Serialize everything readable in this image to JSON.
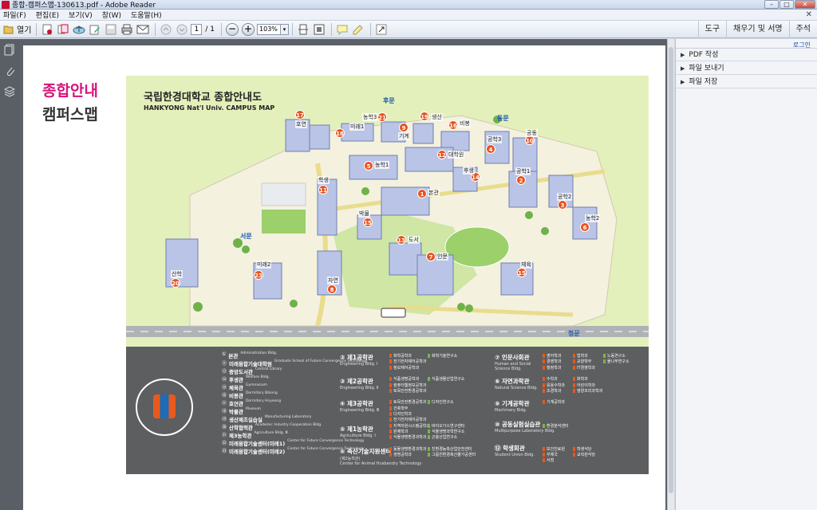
{
  "window": {
    "title": "종합-캠퍼스맵-130613.pdf - Adobe Reader",
    "min": "–",
    "max": "□",
    "close": "✕"
  },
  "menu": {
    "items": [
      "파일(F)",
      "편집(E)",
      "보기(V)",
      "창(W)",
      "도움말(H)"
    ],
    "close": "✕"
  },
  "toolbar": {
    "open_label": "열기",
    "page_current": "1",
    "page_total": "/ 1",
    "zoom": "103%",
    "zoom_out": "−",
    "zoom_in": "+",
    "right_tabs": [
      "도구",
      "채우기 및 서명",
      "주석"
    ]
  },
  "right_pane": {
    "login": "로그인",
    "items": [
      "PDF 작성",
      "파일 보내기",
      "파일 저장"
    ]
  },
  "document": {
    "heading_1": "종합안내",
    "heading_2": "캠퍼스맵",
    "map_title_ko": "국립한경대학교 종합안내도",
    "map_title_en": "HANKYONG Nat'l Univ.  CAMPUS MAP",
    "gates": {
      "back": "후문",
      "east": "동문",
      "west": "서문",
      "main": "정문"
    },
    "map_labels": [
      {
        "num": "17",
        "text": "호연"
      },
      {
        "num": "18",
        "text": "미래1"
      },
      {
        "num": "21",
        "text": "농학3"
      },
      {
        "num": "9",
        "text": "기계"
      },
      {
        "num": "19",
        "text": "생산"
      },
      {
        "num": "16",
        "text": "비봉"
      },
      {
        "num": "4",
        "text": "공학3"
      },
      {
        "num": "10",
        "text": "공동"
      },
      {
        "num": "5",
        "text": "농학1"
      },
      {
        "num": "12",
        "text": "대학원"
      },
      {
        "num": "14",
        "text": "후생"
      },
      {
        "num": "2",
        "text": "공학1"
      },
      {
        "num": "11",
        "text": "학생"
      },
      {
        "num": "1",
        "text": "본관"
      },
      {
        "num": "3",
        "text": "공학2"
      },
      {
        "num": "6",
        "text": "농학2"
      },
      {
        "num": "15",
        "text": "박물"
      },
      {
        "num": "13",
        "text": "도서"
      },
      {
        "num": "7",
        "text": "인문"
      },
      {
        "num": "15",
        "text": "체육"
      },
      {
        "num": "20",
        "text": "산학"
      },
      {
        "num": "23",
        "text": "미래2"
      },
      {
        "num": "8",
        "text": "자연"
      }
    ],
    "legend_left": [
      {
        "num": "①",
        "name": "본관",
        "en": "Administration Bldg."
      },
      {
        "num": "⑪",
        "name": "미래융합기술대학원",
        "en": "Graduate School of Future Convergence Technology"
      },
      {
        "num": "⑬",
        "name": "중앙도서관",
        "en": "Central Library"
      },
      {
        "num": "⑭",
        "name": "후생관",
        "en": "Welfare Bldg."
      },
      {
        "num": "⑮",
        "name": "체육관",
        "en": "Gymnasium"
      },
      {
        "num": "⑯",
        "name": "비봉관",
        "en": "Dormitory Bibong"
      },
      {
        "num": "⑰",
        "name": "호연관",
        "en": "Dormitory Hoyeong"
      },
      {
        "num": "⑱",
        "name": "박물관",
        "en": "Museum"
      },
      {
        "num": "⑲",
        "name": "생산제조실습실",
        "en": "Manufacturing Laboratory"
      },
      {
        "num": "⑳",
        "name": "산학협력관",
        "en": "Academic Industry Cooperation Bldg."
      },
      {
        "num": "㉑",
        "name": "제3농학관",
        "en": "Agriculture Bldg. Ⅲ"
      },
      {
        "num": "㉒",
        "name": "미래융합기술센터(미래1)",
        "en": "Center for Future Convergence Technology"
      },
      {
        "num": "㉓",
        "name": "미래융합기술센터(미래2)",
        "en": "Center for Future Convergence Technology"
      }
    ],
    "legend_mid": [
      {
        "num": "②",
        "name": "제1공학관",
        "en": "Engineering Bldg. Ⅰ"
      },
      {
        "num": "③",
        "name": "제2공학관",
        "en": "Engineering Bldg. Ⅱ"
      },
      {
        "num": "④",
        "name": "제3공학관",
        "en": "Engineering Bldg. Ⅲ"
      },
      {
        "num": "⑤",
        "name": "제1농학관",
        "en": "Agriculture Bldg. Ⅰ"
      },
      {
        "num": "⑥",
        "name": "축산기술지원센터",
        "en": "Center for Animal Husbandry Technology"
      }
    ],
    "legend_mid_sub": "(제2농학관)",
    "legend_right": [
      {
        "num": "⑦",
        "name": "인문사회관",
        "en": "Human and Social Science Bldg."
      },
      {
        "num": "⑧",
        "name": "자연과학관",
        "en": "Natural Science Bldg."
      },
      {
        "num": "⑨",
        "name": "기계공학관",
        "en": "Machinery Bldg."
      },
      {
        "num": "⑩",
        "name": "공동실험실습관",
        "en": "Multipurpose Laboratory Bldg."
      },
      {
        "num": "⑫",
        "name": "학생회관",
        "en": "Student Union Bldg."
      }
    ],
    "depts": [
      {
        "col": 0,
        "row": 0,
        "text": "화학공학과",
        "green": false
      },
      {
        "col": 1,
        "row": 0,
        "text": "화학기술연구소",
        "green": true
      },
      {
        "col": 0,
        "row": 1,
        "text": "전기전자제어공학과",
        "green": false
      },
      {
        "col": 0,
        "row": 2,
        "text": "정보제어공학과",
        "green": false
      },
      {
        "col": 0,
        "row": 4,
        "text": "식품생명공학과",
        "green": false
      },
      {
        "col": 1,
        "row": 4,
        "text": "식품생물산업연구소",
        "green": true
      },
      {
        "col": 0,
        "row": 5,
        "text": "컴퓨터웹정보공학과",
        "green": false
      },
      {
        "col": 0,
        "row": 6,
        "text": "토목안전환경공학과",
        "green": false
      },
      {
        "col": 0,
        "row": 8,
        "text": "토목안전환경공학과",
        "green": false
      },
      {
        "col": 1,
        "row": 8,
        "text": "디자인연구소",
        "green": true
      },
      {
        "col": 0,
        "row": 9,
        "text": "건축학부",
        "green": false
      },
      {
        "col": 0,
        "row": 10,
        "text": "디자인학과",
        "green": false
      },
      {
        "col": 0,
        "row": 11,
        "text": "전기전자제어공학과",
        "green": false
      },
      {
        "col": 0,
        "row": 12,
        "text": "지역자원시스템공학과",
        "green": false
      },
      {
        "col": 1,
        "row": 12,
        "text": "바이오가스연구센터",
        "green": true
      },
      {
        "col": 0,
        "row": 13,
        "text": "원예학과",
        "green": false
      },
      {
        "col": 1,
        "row": 13,
        "text": "식물생명과학연구소",
        "green": true
      },
      {
        "col": 0,
        "row": 14,
        "text": "식물생명환경과학과",
        "green": false
      },
      {
        "col": 1,
        "row": 14,
        "text": "곤충산업연구소",
        "green": true
      },
      {
        "col": 0,
        "row": 16,
        "text": "동물생명환경과학과",
        "green": false
      },
      {
        "col": 1,
        "row": 16,
        "text": "친환경농축산업안전센터",
        "green": true
      },
      {
        "col": 0,
        "row": 17,
        "text": "생명공학과",
        "green": false
      },
      {
        "col": 1,
        "row": 17,
        "text": "그룹친환경축산물가공센터",
        "green": true
      },
      {
        "col": 2,
        "row": 0,
        "text": "영어학과",
        "green": false
      },
      {
        "col": 3,
        "row": 0,
        "text": "법학과",
        "green": false
      },
      {
        "col": 4,
        "row": 0,
        "text": "노동연구소",
        "green": true
      },
      {
        "col": 2,
        "row": 1,
        "text": "경영학과",
        "green": false
      },
      {
        "col": 3,
        "row": 1,
        "text": "교양학부",
        "green": false
      },
      {
        "col": 4,
        "row": 1,
        "text": "물나무연구소",
        "green": true
      },
      {
        "col": 2,
        "row": 2,
        "text": "행정학과",
        "green": false
      },
      {
        "col": 3,
        "row": 2,
        "text": "IT경영학과",
        "green": false
      },
      {
        "col": 2,
        "row": 4,
        "text": "수학과",
        "green": false
      },
      {
        "col": 3,
        "row": 4,
        "text": "화학과",
        "green": false
      },
      {
        "col": 2,
        "row": 5,
        "text": "응용수학과",
        "green": false
      },
      {
        "col": 3,
        "row": 5,
        "text": "어린이학과",
        "green": false
      },
      {
        "col": 2,
        "row": 6,
        "text": "조경학과",
        "green": false
      },
      {
        "col": 3,
        "row": 6,
        "text": "영양조리과학과",
        "green": false
      },
      {
        "col": 2,
        "row": 8,
        "text": "기계공학과",
        "green": false
      },
      {
        "col": 2,
        "row": 12,
        "text": "환경분석센터",
        "green": true
      },
      {
        "col": 2,
        "row": 16,
        "text": "보건진료원",
        "green": false
      },
      {
        "col": 3,
        "row": 16,
        "text": "학생식당",
        "green": false
      },
      {
        "col": 2,
        "row": 17,
        "text": "우체국",
        "green": false
      },
      {
        "col": 3,
        "row": 17,
        "text": "교직원식당",
        "green": false
      },
      {
        "col": 2,
        "row": 18,
        "text": "서점",
        "green": false
      }
    ],
    "seal_text": "국립한경대학교"
  }
}
